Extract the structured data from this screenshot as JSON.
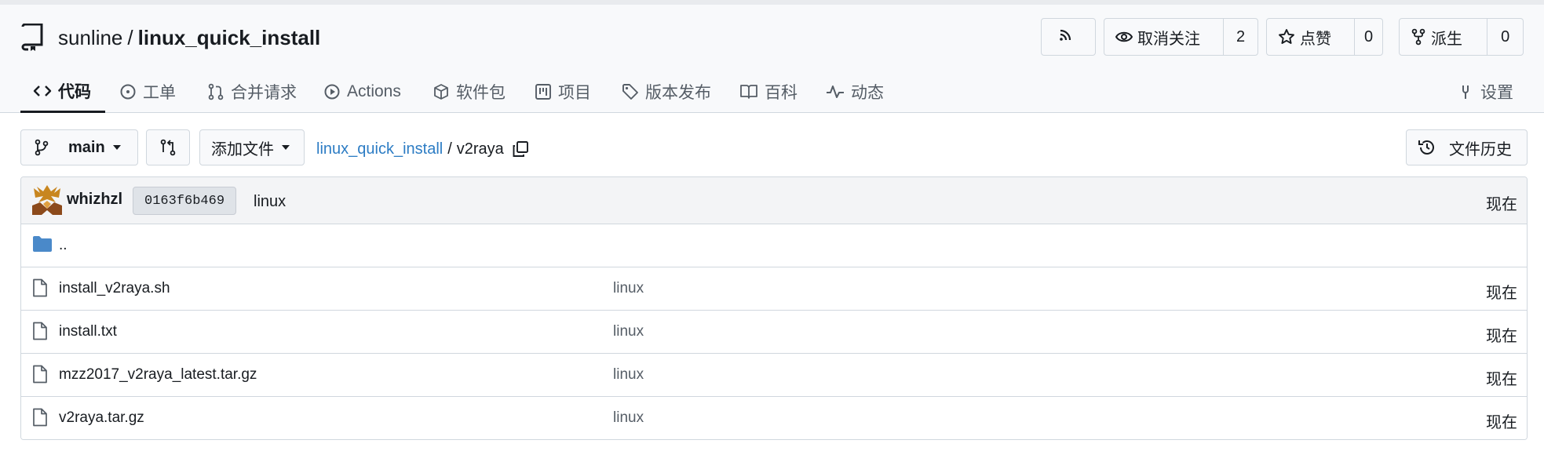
{
  "repo": {
    "owner": "sunline",
    "separator": "/",
    "name": "linux_quick_install"
  },
  "actions": {
    "rss_icon": "rss-icon",
    "watch": {
      "label": "取消关注",
      "count": "2"
    },
    "star": {
      "label": "点赞",
      "count": "0"
    },
    "fork": {
      "label": "派生",
      "count": "0"
    }
  },
  "tabs": [
    {
      "label": "代码",
      "icon": "code-icon",
      "active": true
    },
    {
      "label": "工单",
      "icon": "issue-icon"
    },
    {
      "label": "合并请求",
      "icon": "pull-request-icon"
    },
    {
      "label": "Actions",
      "icon": "play-icon"
    },
    {
      "label": "软件包",
      "icon": "package-icon"
    },
    {
      "label": "项目",
      "icon": "project-icon"
    },
    {
      "label": "版本发布",
      "icon": "tag-icon"
    },
    {
      "label": "百科",
      "icon": "book-icon"
    },
    {
      "label": "动态",
      "icon": "pulse-icon"
    },
    {
      "label": "设置",
      "icon": "tools-icon"
    }
  ],
  "toolbar": {
    "branch": "main",
    "add_file": "添加文件",
    "history": "文件历史"
  },
  "breadcrumb": {
    "root": "linux_quick_install",
    "separator": "/",
    "current": "v2raya"
  },
  "commit": {
    "author": "whizhzl",
    "sha": "0163f6b469",
    "message": "linux",
    "time": "现在"
  },
  "files": [
    {
      "name": "..",
      "type": "folder",
      "message": "",
      "time": ""
    },
    {
      "name": "install_v2raya.sh",
      "type": "file",
      "message": "linux",
      "time": "现在"
    },
    {
      "name": "install.txt",
      "type": "file",
      "message": "linux",
      "time": "现在"
    },
    {
      "name": "mzz2017_v2raya_latest.tar.gz",
      "type": "file",
      "message": "linux",
      "time": "现在"
    },
    {
      "name": "v2raya.tar.gz",
      "type": "file",
      "message": "linux",
      "time": "现在"
    }
  ],
  "colors": {
    "link": "#2c7cc4",
    "folder": "#4a89c9",
    "border": "#d0d7de",
    "header_bg": "#f8f9fb"
  }
}
